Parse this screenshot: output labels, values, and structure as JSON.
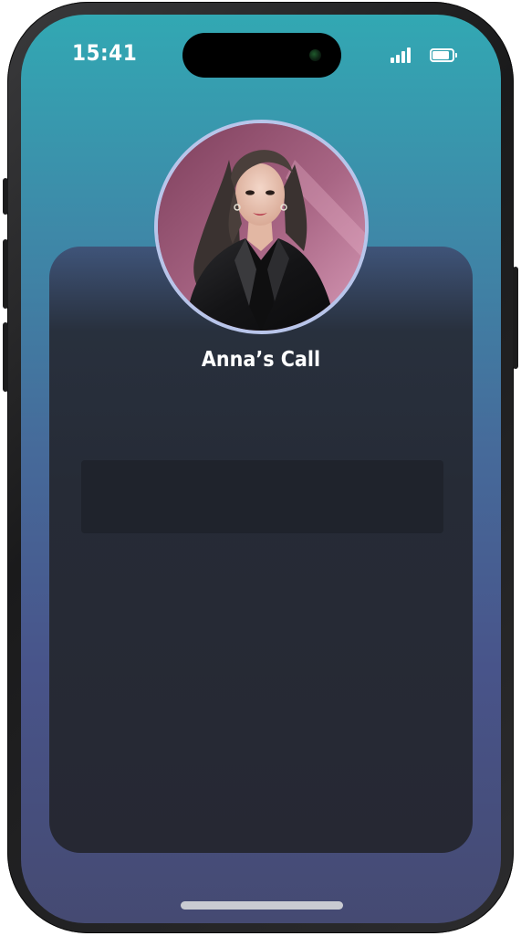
{
  "status_bar": {
    "time": "15:41",
    "signal_icon": "cellular-signal-icon",
    "battery_icon": "battery-icon",
    "battery_level": 0.85
  },
  "call": {
    "caller_name": "Anna’s Call",
    "avatar_icon": "caller-avatar"
  },
  "colors": {
    "background_top": "#32a8b3",
    "background_bottom": "#454a72",
    "card": "#262b36",
    "avatar_ring": "#b8c5ea"
  }
}
